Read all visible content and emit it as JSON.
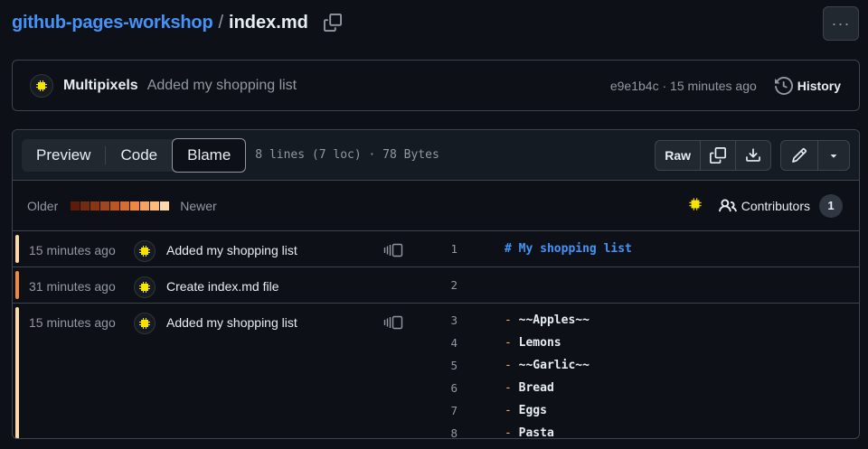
{
  "breadcrumb": {
    "repo": "github-pages-workshop",
    "separator": "/",
    "file": "index.md"
  },
  "more_button": "···",
  "commit": {
    "author": "Multipixels",
    "message": "Added my shopping list",
    "sha": "e9e1b4c",
    "dot": " · ",
    "time": "15 minutes ago",
    "history_label": "History"
  },
  "file": {
    "tabs": [
      "Preview",
      "Code",
      "Blame"
    ],
    "active_tab": "Blame",
    "meta": "8 lines (7 loc) · 78 Bytes",
    "raw_label": "Raw"
  },
  "legend": {
    "older": "Older",
    "newer": "Newer",
    "colors": [
      "#5c1c07",
      "#742c0e",
      "#8c3512",
      "#a3461c",
      "#bd561d",
      "#d86c2c",
      "#f0883e",
      "#f9a35a",
      "#fcbb7b",
      "#ffd8a8"
    ],
    "contributors_label": "Contributors",
    "contributors_count": "1"
  },
  "blame": [
    {
      "time": "15 minutes ago",
      "message": "Added my shopping list",
      "age_color": "#ffd8a8",
      "lines": [
        {
          "n": "1",
          "marker": "",
          "text": "# My shopping list",
          "heading": true
        }
      ]
    },
    {
      "time": "31 minutes ago",
      "message": "Create index.md file",
      "age_color": "#f0883e",
      "lines": [
        {
          "n": "2",
          "marker": "",
          "text": ""
        }
      ]
    },
    {
      "time": "15 minutes ago",
      "message": "Added my shopping list",
      "age_color": "#ffd8a8",
      "lines": [
        {
          "n": "3",
          "marker": "-",
          "text": "~~Apples~~"
        },
        {
          "n": "4",
          "marker": "-",
          "text": "Lemons"
        },
        {
          "n": "5",
          "marker": "-",
          "text": "~~Garlic~~"
        },
        {
          "n": "6",
          "marker": "-",
          "text": "Bread"
        },
        {
          "n": "7",
          "marker": "-",
          "text": "Eggs"
        },
        {
          "n": "8",
          "marker": "-",
          "text": "Pasta"
        }
      ]
    }
  ]
}
